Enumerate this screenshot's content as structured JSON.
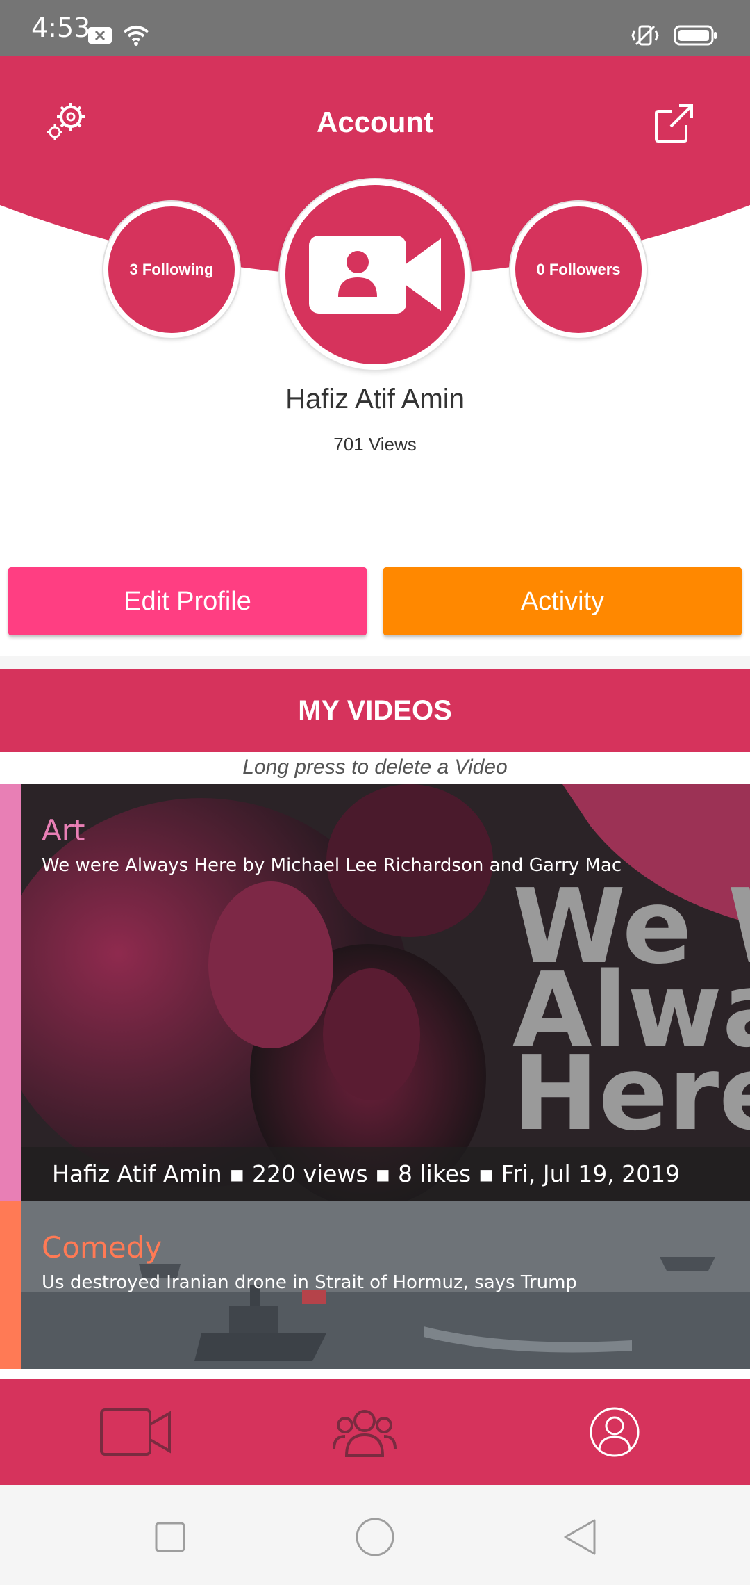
{
  "status_bar": {
    "time": "4:53"
  },
  "header": {
    "title": "Account"
  },
  "profile": {
    "following_label": "3 Following",
    "followers_label": "0 Followers",
    "name": "Hafiz Atif Amin",
    "views_label": "701 Views"
  },
  "actions": {
    "edit_profile": "Edit Profile",
    "activity": "Activity"
  },
  "videos": {
    "section_title": "MY VIDEOS",
    "hint": "Long press to delete a Video",
    "items": [
      {
        "category": "Art",
        "title": "We were Always Here by Michael Lee Richardson and Garry Mac",
        "meta": "Hafiz Atif Amin ▪ 220 views ▪ 8 likes ▪ Fri, Jul 19, 2019",
        "category_color": "#e87fb5",
        "thumb_text": [
          "We We",
          "Alway",
          "Here"
        ]
      },
      {
        "category": "Comedy",
        "title": "Us destroyed Iranian drone in Strait of Hormuz, says Trump",
        "category_color": "#ff7a55"
      }
    ]
  },
  "bottom_nav": {
    "items": [
      "video-camera-icon",
      "group-icon",
      "profile-icon"
    ]
  },
  "colors": {
    "brand": "#d6335c",
    "edit": "#ff3e82",
    "activity": "#ff8800"
  }
}
